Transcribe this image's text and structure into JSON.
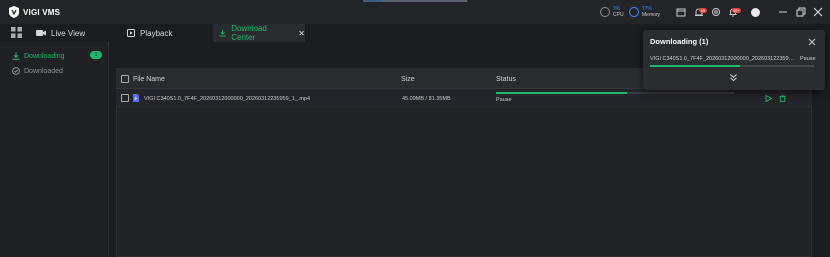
{
  "app": {
    "name": "VIGI VMS"
  },
  "titlebar": {
    "cpu": {
      "percent": "3%",
      "label": "CPU",
      "level": 0.03
    },
    "memory": {
      "percent": "77%",
      "label": "Memory",
      "level": 0.77
    },
    "icons": [
      "window-icon",
      "alarm-icon",
      "settings-icon",
      "bell-icon",
      "avatar",
      "minimize-icon",
      "restore-icon",
      "close-icon"
    ],
    "alarm_badge": "99",
    "bell_badge": "99+",
    "badge_color": "#e5403a"
  },
  "tabs": [
    {
      "label": "Live View",
      "icon": "camera-icon"
    },
    {
      "label": "Playback",
      "icon": "playback-icon"
    },
    {
      "label": "Download Center",
      "icon": "download-icon",
      "active": true
    }
  ],
  "sidebar": {
    "items": [
      {
        "label": "Downloading",
        "icon": "download-icon",
        "count": "1",
        "active": true
      },
      {
        "label": "Downloaded",
        "icon": "check-circle-icon",
        "active": false
      }
    ]
  },
  "table": {
    "columns": [
      "File Name",
      "Size",
      "Status"
    ],
    "rows": [
      {
        "file_name": "VIGI C340S1.0_7F4F_20260312000000_20260312235959_1_.mp4",
        "size": "45.09MB / 81.35MB",
        "status": "Pause",
        "progress": 0.55
      }
    ]
  },
  "popup": {
    "title": "Downloading (1)",
    "file_name": "VIGI C340S1.0_7F4F_20260312000000_20260312235959_1_.mp4",
    "file_display": "VIGI C340S1.0_7F4F_20260312000000_20260312235959_...",
    "status": "Pause",
    "progress": 0.55
  },
  "colors": {
    "accent": "#1fb86a",
    "info_blue": "#2f8cff",
    "background": "#202124"
  }
}
